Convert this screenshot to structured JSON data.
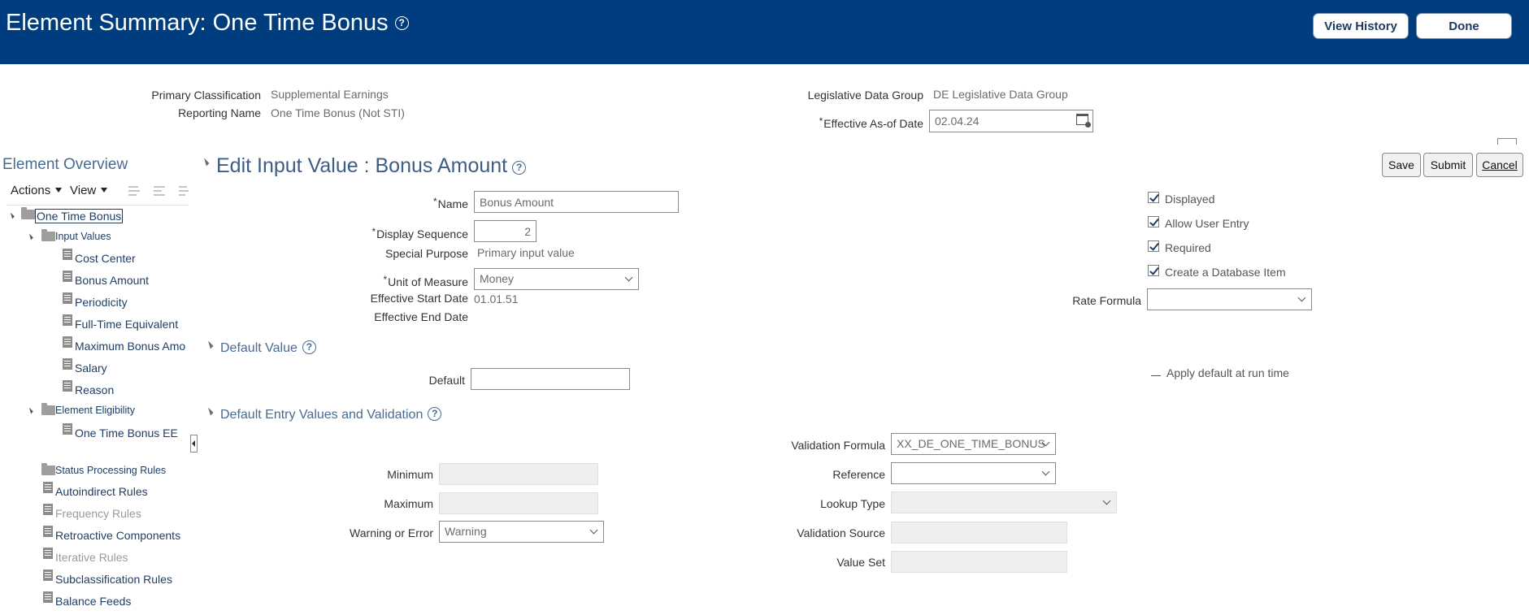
{
  "header": {
    "title": "Element Summary: One Time Bonus",
    "help_glyph": "?",
    "view_history_label": "View History",
    "done_label": "Done"
  },
  "summary": {
    "primary_classification_label": "Primary Classification",
    "primary_classification_value": "Supplemental Earnings",
    "reporting_name_label": "Reporting Name",
    "reporting_name_value": "One Time Bonus (Not STI)",
    "ldg_label": "Legislative Data Group",
    "ldg_value": "DE Legislative Data Group",
    "effective_date_label": "Effective As-of Date",
    "effective_date_value": "02.04.24",
    "required_marker": "*"
  },
  "sidebar": {
    "title": "Element Overview",
    "actions_label": "Actions",
    "view_label": "View",
    "tree": {
      "root": "One Time Bonus",
      "input_values_folder": "Input Values",
      "input_values": [
        "Cost Center",
        "Bonus Amount",
        "Periodicity",
        "Full-Time Equivalent",
        "Maximum Bonus Amo",
        "Salary",
        "Reason"
      ],
      "eligibility_folder": "Element Eligibility",
      "eligibility_items": [
        "One Time Bonus EE"
      ],
      "status_folder": "Status Processing Rules",
      "other_items": [
        {
          "label": "Autoindirect Rules",
          "enabled": true
        },
        {
          "label": "Frequency Rules",
          "enabled": false
        },
        {
          "label": "Retroactive Components",
          "enabled": true
        },
        {
          "label": "Iterative Rules",
          "enabled": false
        },
        {
          "label": "Subclassification Rules",
          "enabled": true
        },
        {
          "label": "Balance Feeds",
          "enabled": true
        }
      ]
    }
  },
  "edit": {
    "title": "Edit Input Value : Bonus Amount",
    "save_label": "Save",
    "submit_label": "Submit",
    "cancel_label": "Cancel",
    "name_label": "Name",
    "name_value": "Bonus Amount",
    "display_sequence_label": "Display Sequence",
    "display_sequence_value": "2",
    "special_purpose_label": "Special Purpose",
    "special_purpose_value": "Primary input value",
    "uom_label": "Unit of Measure",
    "uom_value": "Money",
    "start_date_label": "Effective Start Date",
    "start_date_value": "01.01.51",
    "end_date_label": "Effective End Date",
    "checkboxes": [
      {
        "label": "Displayed",
        "checked": true
      },
      {
        "label": "Allow User Entry",
        "checked": true
      },
      {
        "label": "Required",
        "checked": true
      },
      {
        "label": "Create a Database Item",
        "checked": true
      }
    ],
    "rate_formula_label": "Rate Formula",
    "rate_formula_value": ""
  },
  "default_value": {
    "title": "Default Value",
    "default_label": "Default",
    "default_value": "",
    "apply_default_label": "Apply default at run time"
  },
  "validation": {
    "title": "Default Entry Values and Validation",
    "minimum_label": "Minimum",
    "maximum_label": "Maximum",
    "warning_error_label": "Warning or Error",
    "warning_error_value": "Warning",
    "validation_formula_label": "Validation Formula",
    "validation_formula_value": "XX_DE_ONE_TIME_BONUS",
    "reference_label": "Reference",
    "reference_value": "",
    "lookup_type_label": "Lookup Type",
    "validation_source_label": "Validation Source",
    "value_set_label": "Value Set"
  },
  "icons": {
    "help": "help-circle-icon",
    "calendar": "calendar-icon",
    "folder": "folder-icon",
    "document": "document-icon",
    "expand": "expand-triangle-icon",
    "dropdown": "chevron-down-icon"
  },
  "colors": {
    "header_bg": "#003d7e",
    "link": "#1f3e64",
    "section_title": "#3d5d85"
  }
}
